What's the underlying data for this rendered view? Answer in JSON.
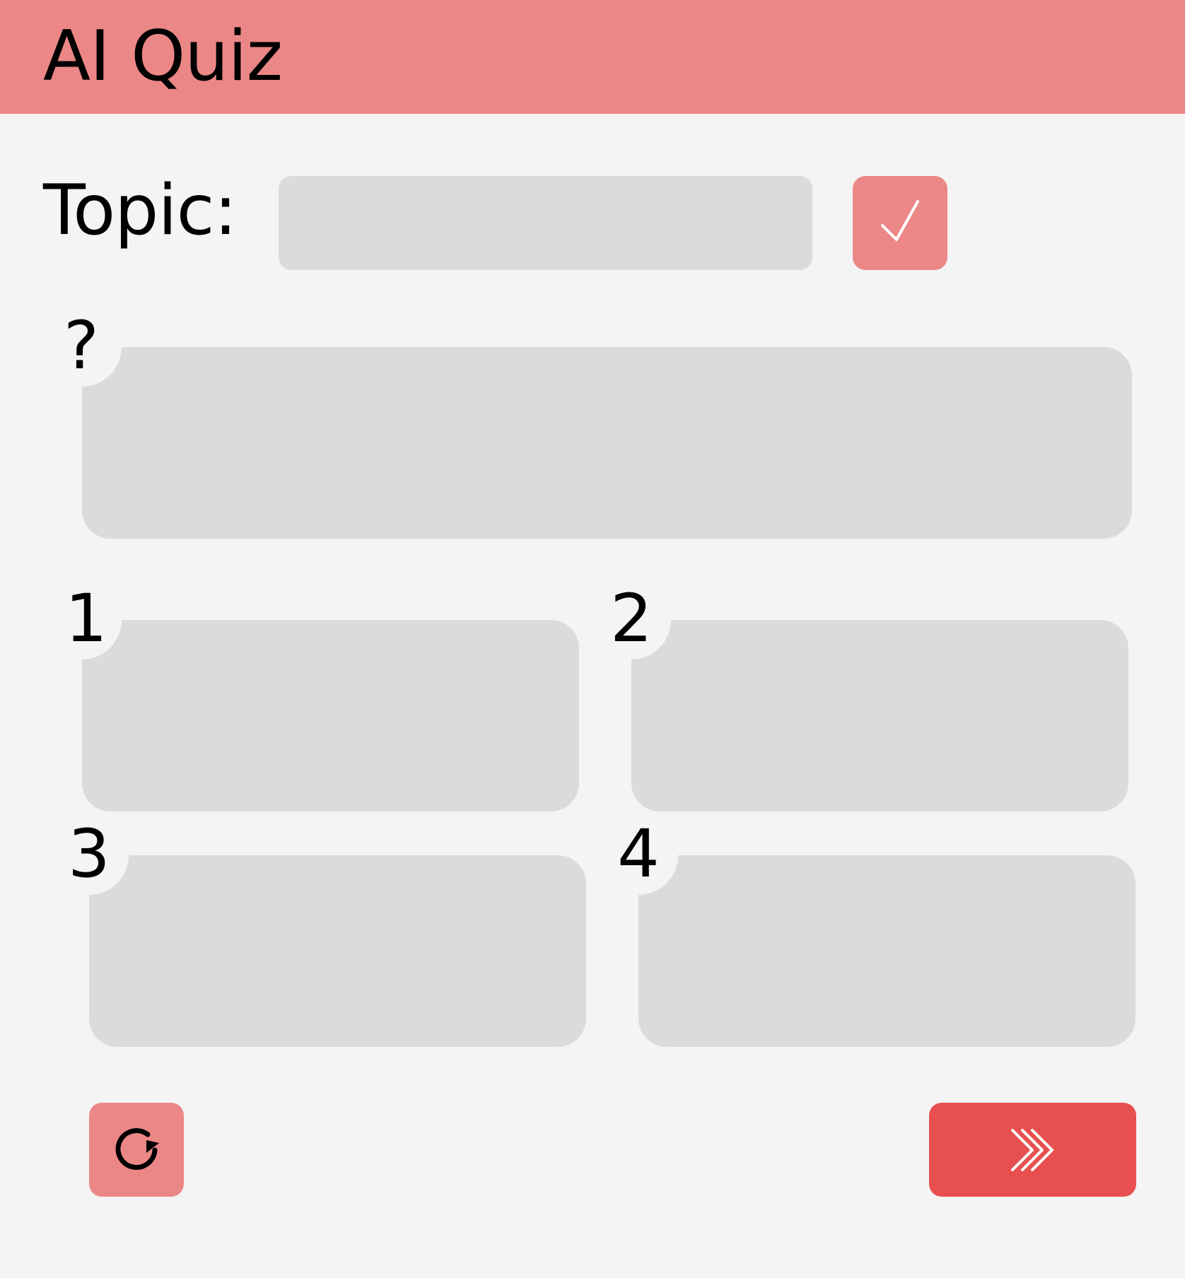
{
  "header": {
    "title": "AI Quiz",
    "background_color": "#ec8787"
  },
  "topic": {
    "label": "Topic:",
    "value": "",
    "confirm_icon": "checkmark-icon"
  },
  "question": {
    "marker": "?",
    "text": ""
  },
  "answers": [
    {
      "number": "1",
      "text": ""
    },
    {
      "number": "2",
      "text": ""
    },
    {
      "number": "3",
      "text": ""
    },
    {
      "number": "4",
      "text": ""
    }
  ],
  "footer": {
    "refresh_icon": "refresh-icon",
    "next_icon": "triple-chevron-right-icon"
  },
  "colors": {
    "accent": "#ec8787",
    "primary": "#e84f4f",
    "field": "#dbdbdb",
    "background": "#f4f4f4"
  }
}
